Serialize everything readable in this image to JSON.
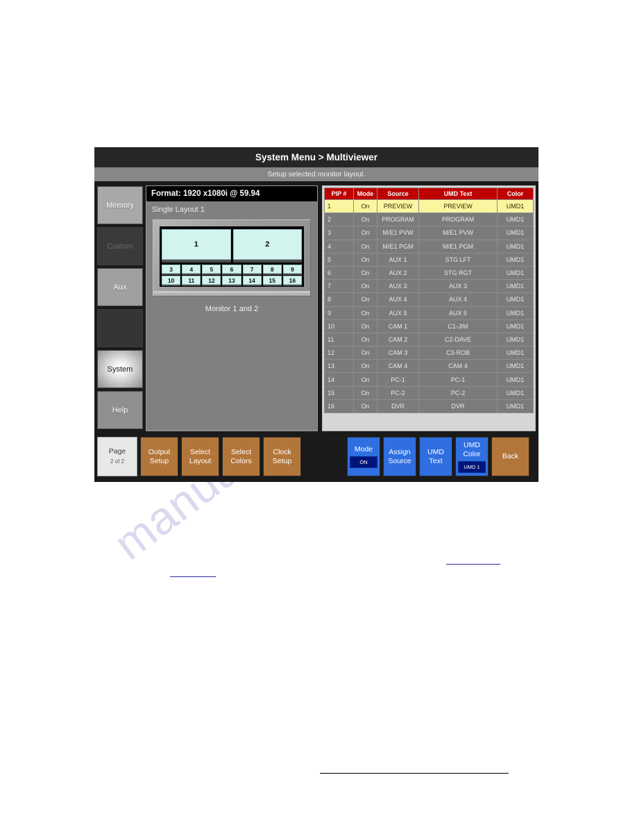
{
  "watermark": {
    "text": "manualslib.com"
  },
  "device": {
    "title": "System Menu > Multiviewer",
    "subtitle": "Setup selected monitor layout.",
    "rail": [
      {
        "name": "memory",
        "label": "Memory",
        "state": "normal"
      },
      {
        "name": "custom",
        "label": "Custom",
        "state": "disabled"
      },
      {
        "name": "aux",
        "label": "Aux",
        "state": "normal"
      },
      {
        "name": "blank",
        "label": "",
        "state": "empty"
      },
      {
        "name": "system",
        "label": "System",
        "state": "active"
      },
      {
        "name": "help",
        "label": "Help",
        "state": "normal"
      }
    ],
    "preview": {
      "format": "Format: 1920 x1080i @ 59.94",
      "layout_name": "Single Layout 1",
      "caption": "Monitor 1 and 2",
      "big_pips": [
        "1",
        "2"
      ],
      "row_a": [
        "3",
        "4",
        "5",
        "6",
        "7",
        "8",
        "9"
      ],
      "row_b": [
        "10",
        "11",
        "12",
        "13",
        "14",
        "15",
        "16"
      ]
    },
    "table": {
      "headers": [
        "PIP #",
        "Mode",
        "Source",
        "UMD Text",
        "Color"
      ],
      "selected_index": 0,
      "rows": [
        {
          "pip": "1",
          "mode": "On",
          "source": "PREVIEW",
          "umd": "PREVIEW",
          "color": "UMD1"
        },
        {
          "pip": "2",
          "mode": "On",
          "source": "PROGRAM",
          "umd": "PROGRAM",
          "color": "UMD1"
        },
        {
          "pip": "3",
          "mode": "On",
          "source": "M/E1 PVW",
          "umd": "M/E1 PVW",
          "color": "UMD1"
        },
        {
          "pip": "4",
          "mode": "On",
          "source": "M/E1 PGM",
          "umd": "M/E1 PGM",
          "color": "UMD1"
        },
        {
          "pip": "5",
          "mode": "On",
          "source": "AUX 1",
          "umd": "STG LFT",
          "color": "UMD1"
        },
        {
          "pip": "6",
          "mode": "On",
          "source": "AUX 2",
          "umd": "STG RGT",
          "color": "UMD1"
        },
        {
          "pip": "7",
          "mode": "On",
          "source": "AUX 3",
          "umd": "AUX 3",
          "color": "UMD1"
        },
        {
          "pip": "8",
          "mode": "On",
          "source": "AUX 4",
          "umd": "AUX 4",
          "color": "UMD1"
        },
        {
          "pip": "9",
          "mode": "On",
          "source": "AUX 5",
          "umd": "AUX 5",
          "color": "UMD1"
        },
        {
          "pip": "10",
          "mode": "On",
          "source": "CAM 1",
          "umd": "C1-JIM",
          "color": "UMD1"
        },
        {
          "pip": "11",
          "mode": "On",
          "source": "CAM 2",
          "umd": "C2-DAVE",
          "color": "UMD1"
        },
        {
          "pip": "12",
          "mode": "On",
          "source": "CAM 3",
          "umd": "C3-ROB",
          "color": "UMD1"
        },
        {
          "pip": "13",
          "mode": "On",
          "source": "CAM 4",
          "umd": "CAM 4",
          "color": "UMD1"
        },
        {
          "pip": "14",
          "mode": "On",
          "source": "PC-1",
          "umd": "PC-1",
          "color": "UMD1"
        },
        {
          "pip": "15",
          "mode": "On",
          "source": "PC-2",
          "umd": "PC-2",
          "color": "UMD1"
        },
        {
          "pip": "16",
          "mode": "On",
          "source": "DVR",
          "umd": "DVR",
          "color": "UMD1"
        }
      ]
    },
    "footer": {
      "page": {
        "label": "Page",
        "sub": "2 of 2"
      },
      "brown_buttons": [
        {
          "name": "output-setup",
          "line1": "Output",
          "line2": "Setup"
        },
        {
          "name": "select-layout",
          "line1": "Select",
          "line2": "Layout"
        },
        {
          "name": "select-colors",
          "line1": "Select",
          "line2": "Colors"
        },
        {
          "name": "clock-setup",
          "line1": "Clock",
          "line2": "Setup"
        }
      ],
      "blue_buttons": [
        {
          "name": "mode",
          "line1": "Mode",
          "line2": "",
          "badge": "ON"
        },
        {
          "name": "assign-source",
          "line1": "Assign",
          "line2": "Source",
          "badge": ""
        },
        {
          "name": "umd-text",
          "line1": "UMD",
          "line2": "Text",
          "badge": ""
        },
        {
          "name": "umd-color",
          "line1": "UMD",
          "line2": "Color",
          "badge": "UMD 1"
        }
      ],
      "back": {
        "label": "Back"
      }
    },
    "colors": {
      "header_red": "#be0000",
      "selected_yellow": "#faf6a0",
      "brown": "#b3763a",
      "blue": "#2f6fe0",
      "badge_navy": "#00157a",
      "pip_cyan": "#d2f3ee"
    }
  }
}
